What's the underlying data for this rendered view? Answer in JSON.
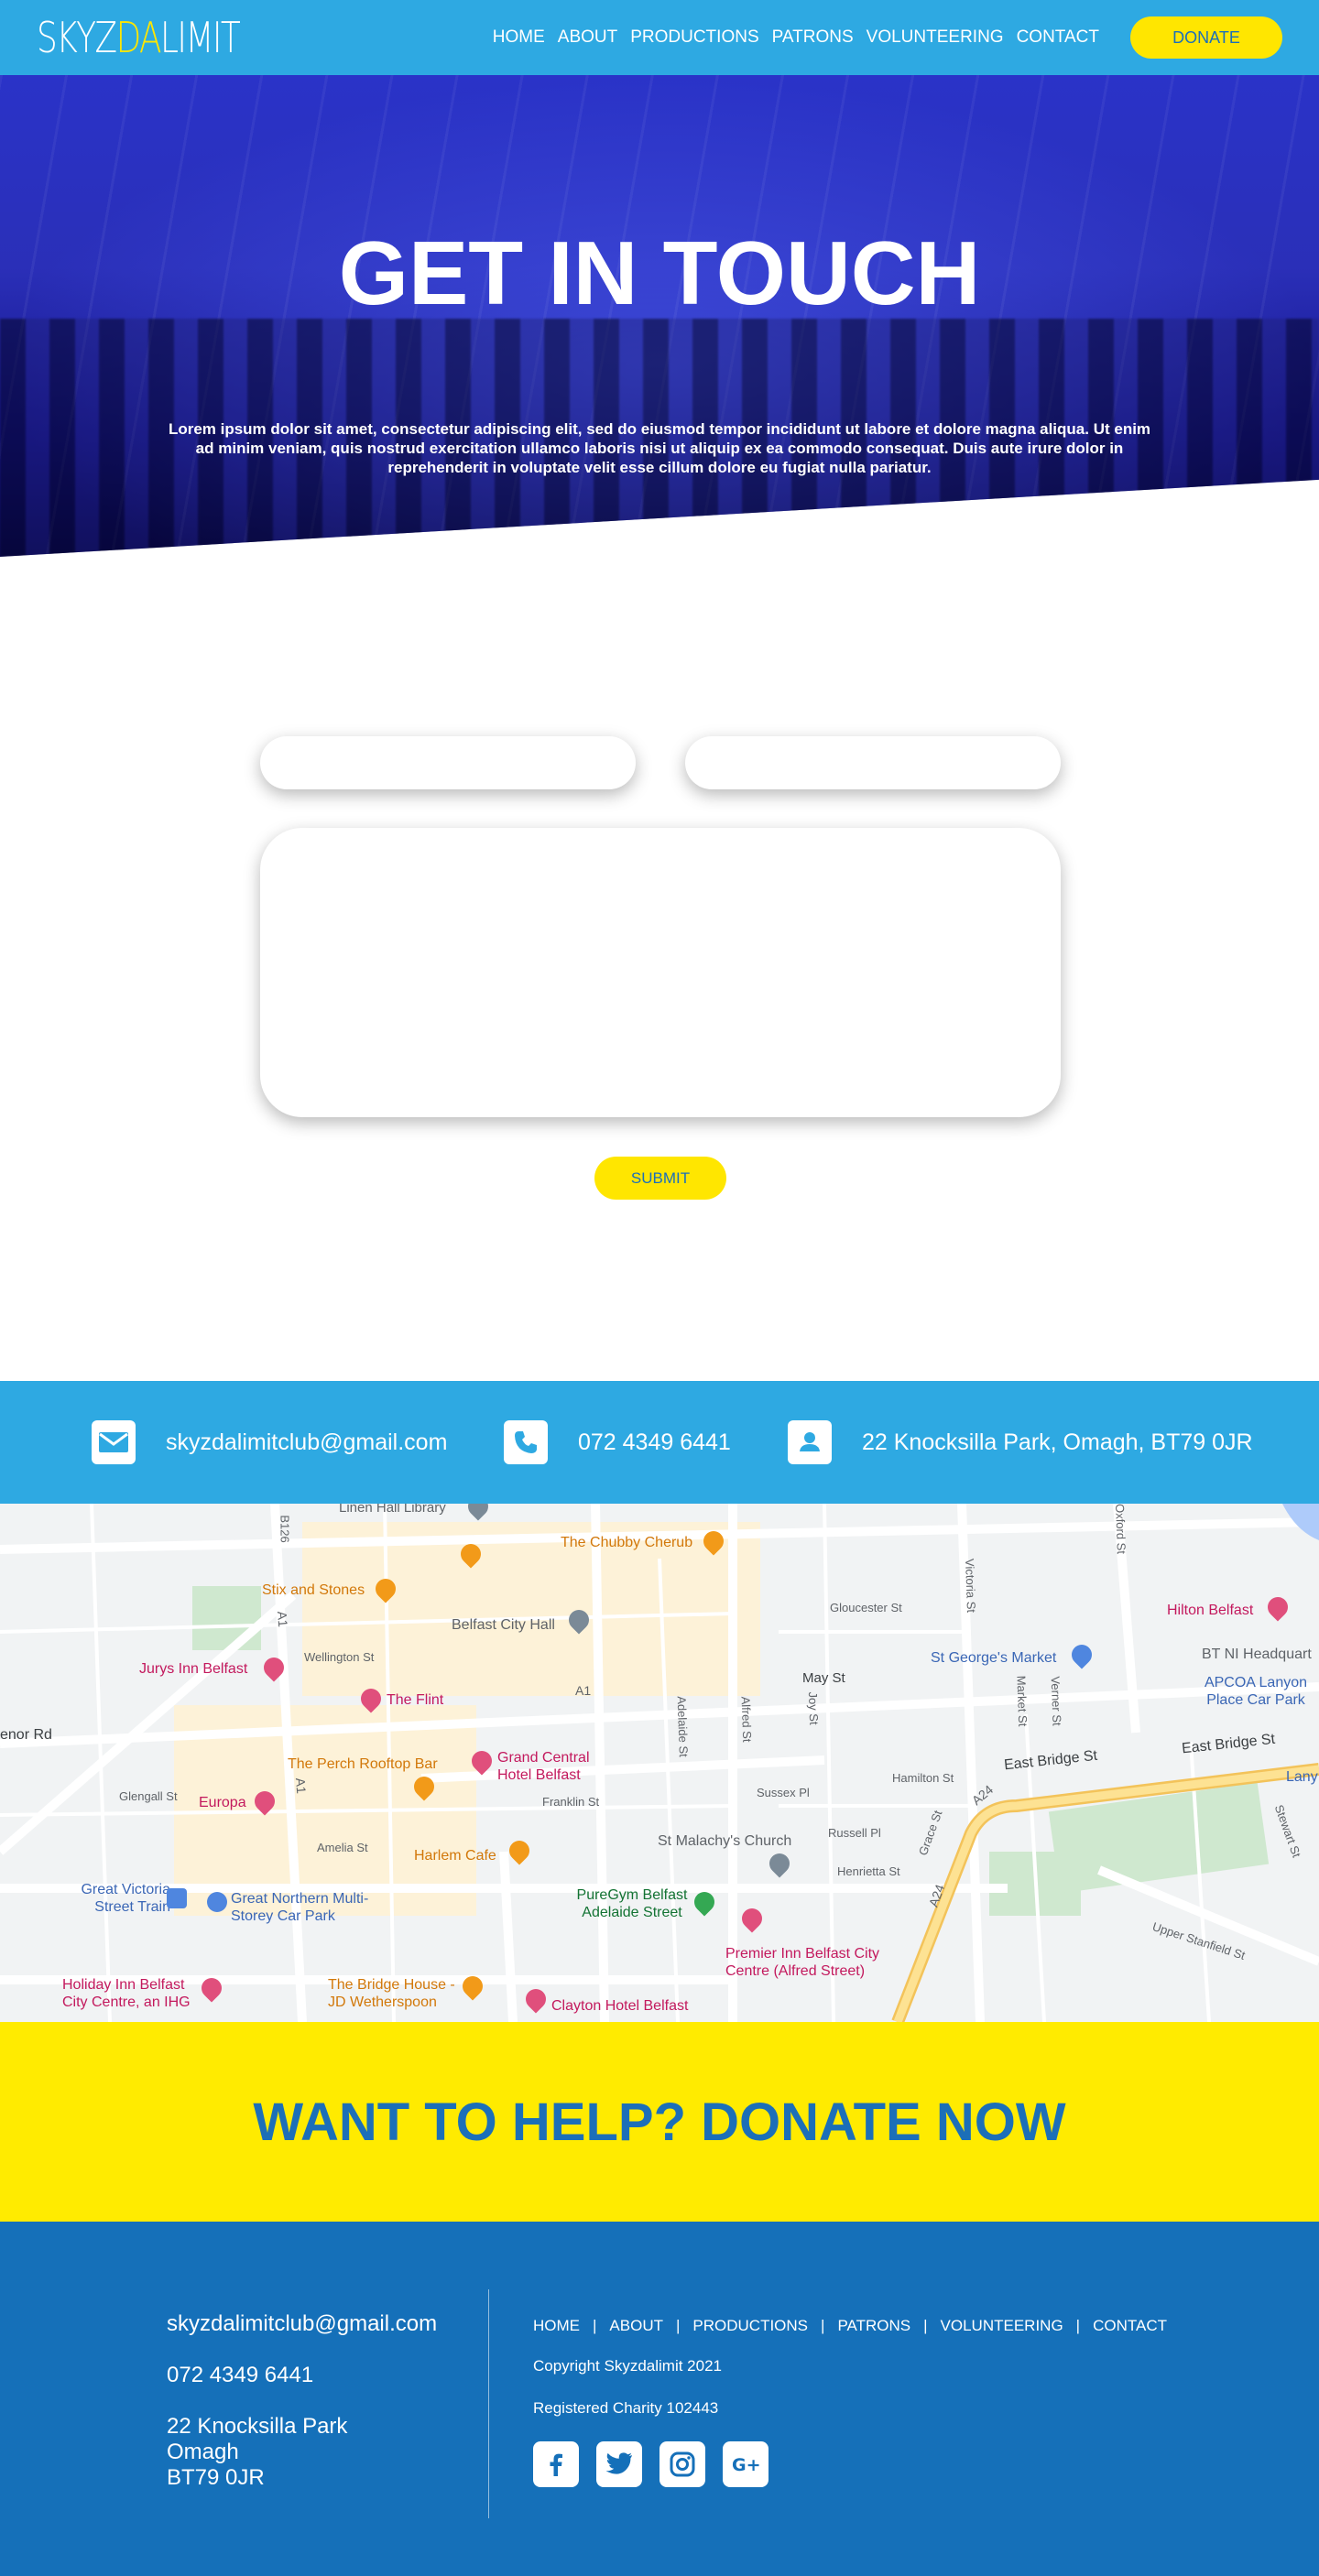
{
  "nav": {
    "logo_part1": "SKYZ",
    "logo_part2": "DA",
    "logo_part3": "LIMIT",
    "links": [
      "HOME",
      "ABOUT",
      "PRODUCTIONS",
      "PATRONS",
      "VOLUNTEERING",
      "CONTACT"
    ],
    "donate_label": "DONATE"
  },
  "hero": {
    "title": "GET IN TOUCH",
    "text": "Lorem ipsum dolor sit amet, consectetur adipiscing elit, sed do eiusmod tempor incididunt ut labore et dolore magna aliqua. Ut enim ad minim veniam, quis nostrud exercitation ullamco laboris nisi ut aliquip ex ea commodo consequat. Duis aute irure dolor in reprehenderit in voluptate velit esse cillum dolore eu fugiat nulla pariatur."
  },
  "form": {
    "name_value": "",
    "email_value": "",
    "message_value": "",
    "submit_label": "SUBMIT"
  },
  "contact": {
    "email": "skyzdalimitclub@gmail.com",
    "phone": "072 4349 6441",
    "address": "22 Knocksilla Park, Omagh, BT79 0JR"
  },
  "map": {
    "labels": {
      "linen_hall": "Linen Hall Library",
      "chubby": "The Chubby Cherub",
      "stix": "Stix and Stones",
      "city_hall": "Belfast City Hall",
      "jurys": "Jurys Inn Belfast",
      "flint": "The Flint",
      "perch": "The Perch Rooftop Bar",
      "grand_central": "Grand Central Hotel Belfast",
      "europa": "Europa",
      "harlem": "Harlem Cafe",
      "malachy": "St Malachy's Church",
      "puregym": "PureGym Belfast Adelaide Street",
      "premier": "Premier Inn Belfast City Centre (Alfred Street)",
      "great_victoria": "Great Victoria Street Train",
      "great_northern": "Great Northern Multi-Storey Car Park",
      "holiday_inn": "Holiday Inn Belfast City Centre, an IHG",
      "bridge_house": "The Bridge House - JD Wetherspoon",
      "clayton": "Clayton Hotel Belfast",
      "hilton": "Hilton Belfast",
      "st_georges": "St George's Market",
      "bt_ni": "BT NI Headquart",
      "apcoa": "APCOA Lanyon Place Car Park",
      "lany": "Lany",
      "may_st": "May St",
      "east_bridge": "East Bridge St",
      "a1": "A1",
      "a24": "A24",
      "b126": "B126",
      "victoria_st": "Victoria St",
      "oxford_st": "Oxford St",
      "gloucester": "Gloucester St",
      "wellington": "Wellington St",
      "franklin": "Franklin St",
      "amelia": "Amelia St",
      "glengall": "Glengall St",
      "adelaide": "Adelaide St",
      "alfred": "Alfred St",
      "joy": "Joy St",
      "sussex": "Sussex Pl",
      "hamilton": "Hamilton St",
      "russell": "Russell Pl",
      "henrietta": "Henrietta St",
      "upper_stanfield": "Upper Stanfield St",
      "stewart": "Stewart St",
      "market": "Market St",
      "verner": "Verner St",
      "grace": "Grace St",
      "lenor": "enor Rd"
    }
  },
  "donate_banner": {
    "text": "WANT TO HELP? DONATE NOW"
  },
  "footer": {
    "email": "skyzdalimitclub@gmail.com",
    "phone": "072 4349 6441",
    "address_line1": "22 Knocksilla Park",
    "address_line2": "Omagh",
    "address_line3": "BT79 0JR",
    "links": [
      "HOME",
      "ABOUT",
      "PRODUCTIONS",
      "PATRONS",
      "VOLUNTEERING",
      "CONTACT"
    ],
    "copyright": "Copyright Skyzdalimit 2021",
    "charity": "Registered Charity 102443",
    "social": [
      "facebook-icon",
      "twitter-icon",
      "instagram-icon",
      "google-plus-icon"
    ]
  },
  "colors": {
    "brand_blue": "#2ea9e2",
    "footer_blue": "#1570b9",
    "yellow": "#ffe600",
    "donate_text": "#1c6fb8"
  }
}
